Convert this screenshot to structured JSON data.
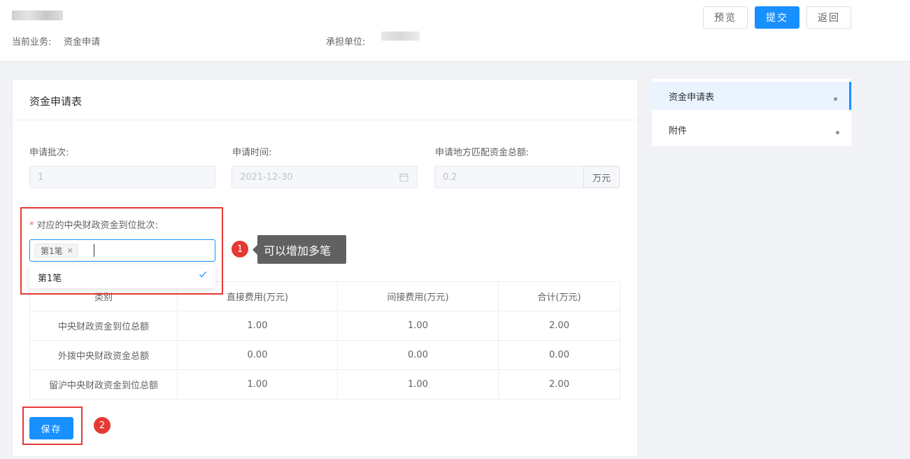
{
  "header": {
    "business_label": "当前业务:",
    "business_value": "资金申请",
    "unit_label": "承担单位:",
    "buttons": {
      "preview": "预览",
      "submit": "提交",
      "back": "返回"
    }
  },
  "form": {
    "title": "资金申请表",
    "batch_label": "申请批次:",
    "batch_value": "1",
    "date_label": "申请时间:",
    "date_value": "2021-12-30",
    "match_label": "申请地方匹配资金总额:",
    "match_value": "0.2",
    "match_unit": "万元",
    "central_required": "*",
    "central_label": "对应的中央财政资金到位批次:",
    "selected_tag": "第1笔",
    "dropdown_option": "第1笔",
    "save_label": "保存"
  },
  "table": {
    "headers": [
      "类别",
      "直接费用(万元)",
      "间接费用(万元)",
      "合计(万元)"
    ],
    "rows": [
      [
        "中央财政资金到位总额",
        "1.00",
        "1.00",
        "2.00"
      ],
      [
        "外拨中央财政资金总额",
        "0.00",
        "0.00",
        "0.00"
      ],
      [
        "留沪中央财政资金到位总额",
        "1.00",
        "1.00",
        "2.00"
      ]
    ]
  },
  "sidebar": {
    "items": [
      {
        "label": "资金申请表"
      },
      {
        "label": "附件"
      }
    ]
  },
  "annotations": {
    "badge1": "1",
    "badge2": "2",
    "tooltip": "可以增加多笔"
  },
  "colors": {
    "primary": "#1890ff",
    "annotation_red": "#e53935",
    "required": "#f56c6c"
  }
}
